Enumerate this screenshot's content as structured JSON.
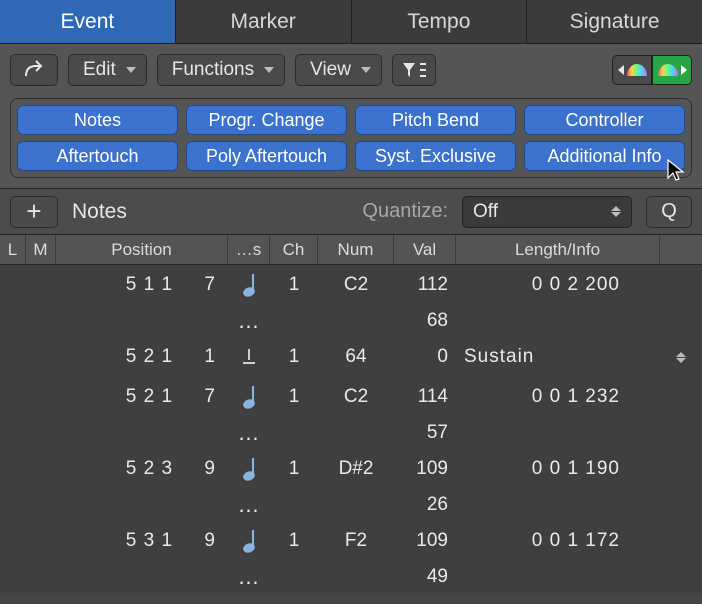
{
  "tabs": [
    "Event",
    "Marker",
    "Tempo",
    "Signature"
  ],
  "active_tab": 0,
  "toolbar": {
    "edit": "Edit",
    "functions": "Functions",
    "view": "View"
  },
  "filters": {
    "row1": [
      "Notes",
      "Progr. Change",
      "Pitch Bend",
      "Controller"
    ],
    "row2": [
      "Aftertouch",
      "Poly Aftertouch",
      "Syst. Exclusive",
      "Additional Info"
    ]
  },
  "secondary": {
    "mode": "Notes",
    "quantize_label": "Quantize:",
    "quantize_value": "Off",
    "q_button": "Q"
  },
  "columns": {
    "l": "L",
    "m": "M",
    "position": "Position",
    "status": "…s",
    "ch": "Ch",
    "num": "Num",
    "val": "Val",
    "length": "Length/Info"
  },
  "rows": [
    {
      "pos": "5 1 1     7",
      "glyph": "note",
      "ch": "1",
      "num": "C2",
      "val": "112",
      "val2": "68",
      "len": "0 0 2 200",
      "dots": true
    },
    {
      "pos": "5 2 1     1",
      "glyph": "sustain",
      "ch": "1",
      "num": "64",
      "val": "0",
      "len_text": "Sustain",
      "stepper": true
    },
    {
      "pos": "5 2 1     7",
      "glyph": "note",
      "ch": "1",
      "num": "C2",
      "val": "114",
      "val2": "57",
      "len": "0 0 1 232",
      "dots": true
    },
    {
      "pos": "5 2 3     9",
      "glyph": "note",
      "ch": "1",
      "num": "D#2",
      "val": "109",
      "val2": "26",
      "len": "0 0 1 190",
      "dots": true
    },
    {
      "pos": "5 3 1     9",
      "glyph": "note",
      "ch": "1",
      "num": "F2",
      "val": "109",
      "val2": "49",
      "len": "0 0 1 172",
      "dots": true
    }
  ]
}
